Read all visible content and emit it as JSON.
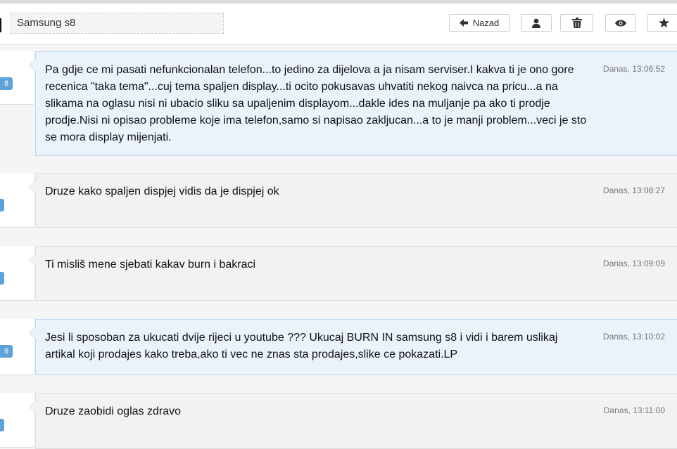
{
  "header": {
    "subject": "Samsung s8",
    "back_label": "Nazad",
    "icons": {
      "back": "arrow-left-icon",
      "user": "user-icon",
      "trash": "trash-icon",
      "eye": "eye-icon",
      "star": "star-icon"
    }
  },
  "colors": {
    "badge": "#5da3da",
    "bubble_blue": "#eaf2fb",
    "bubble_gray": "#f2f2f2"
  },
  "messages": [
    {
      "badge": "8",
      "text": "Pa gdje ce mi pasati nefunkcionalan telefon...to jedino za dijelova a ja nisam serviser.I kakva ti je ono gore recenica \"taka tema\"...cuj tema spaljen display...ti ocito pokusavas uhvatiti nekog naivca na pricu...a na slikama na oglasu nisi ni ubacio sliku sa upaljenim displayom...dakle ides na muljanje pa ako ti prodje prodje.Nisi ni opisao probleme koje ima telefon,samo si napisao zakljucan...a to je manji problem...veci je sto se mora display mijenjati.",
      "time": "Danas, 13:06:52"
    },
    {
      "badge": "",
      "text": "Druze kako spaljen dispjej vidis da je dispjej ok",
      "time": "Danas, 13:08:27"
    },
    {
      "badge": "",
      "text": "Ti misliš mene sjebati kakav burn i bakraci",
      "time": "Danas, 13:09:09"
    },
    {
      "badge": "8",
      "text": "Jesi li sposoban za ukucati dvije rijeci u youtube ??? Ukucaj BURN IN samsung s8 i vidi i barem uslikaj artikal koji prodajes kako treba,ako ti vec ne znas sta prodajes,slike ce pokazati.LP",
      "time": "Danas, 13:10:02"
    },
    {
      "badge": "",
      "text": "Druze zaobidi oglas zdravo",
      "time": "Danas, 13:11:00"
    }
  ]
}
